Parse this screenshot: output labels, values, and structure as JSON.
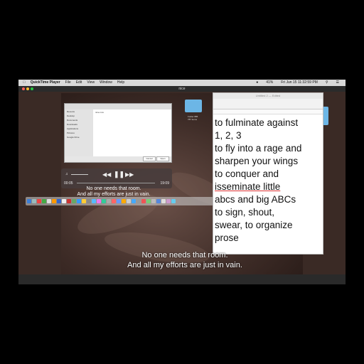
{
  "menubar": {
    "app": "QuickTime Player",
    "items": [
      "File",
      "Edit",
      "View",
      "Window",
      "Help"
    ],
    "clock": "Fri Jun 15 11:32:59 PM",
    "battery": "41%"
  },
  "player": {
    "title": "nice",
    "time_elapsed": "00:05",
    "time_remaining": "19:09"
  },
  "finder": {
    "sidebar": [
      "Recents",
      "Desktop",
      "Documents",
      "Downloads",
      "Applications",
      "Pictures",
      "Google Drive"
    ],
    "file": "nice.mov",
    "cancel": "Cancel",
    "open": "Open"
  },
  "editor": {
    "title": "Untitled 2 — Edited",
    "lines": [
      "to fulminate against",
      "1, 2, 3",
      "to fly into a rage and",
      "sharpen your wings",
      "to conquer and",
      "isseminate little",
      "abcs and big ABCs",
      "to sign, shout,",
      "swear, to organize",
      "prose"
    ]
  },
  "subtitles": {
    "small_1": "No one needs that room.",
    "small_2": "And all my efforts are just in vain.",
    "main_1": "No one needs that room.",
    "main_2": "And all my efforts are just in vain."
  },
  "desktop": {
    "folder_label_1": "Folder 885",
    "folder_label_2": "787 items"
  },
  "colors": {
    "menubar": "#d9d9d9",
    "folder": "#6cb6e6",
    "video": "#4a3530"
  }
}
